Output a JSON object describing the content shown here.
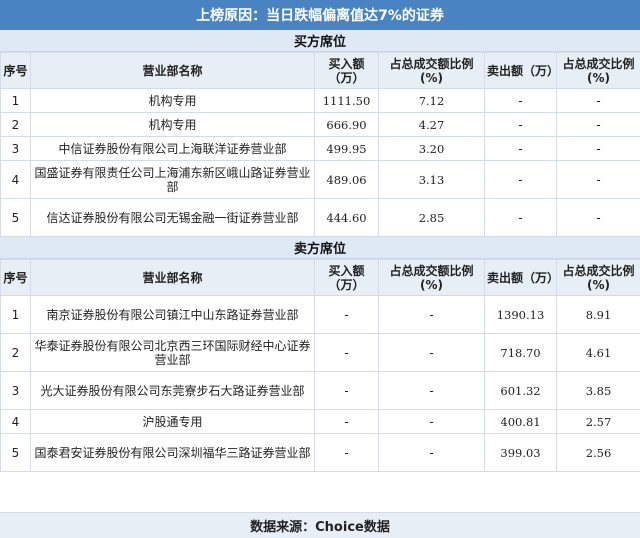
{
  "title": "上榜原因：当日跌幅偏离值达7%的证券",
  "buy": {
    "section_label": "买方席位",
    "headers": [
      "序号",
      "营业部名称",
      "买入额（万）",
      "占总成交额比例(%)",
      "卖出额（万）",
      "占总成交比例(%)"
    ],
    "rows": [
      [
        "1",
        "机构专用",
        "1111.50",
        "7.12",
        "-",
        "-"
      ],
      [
        "2",
        "机构专用",
        "666.90",
        "4.27",
        "-",
        "-"
      ],
      [
        "3",
        "中信证券股份有限公司上海联洋证券营业部",
        "499.95",
        "3.20",
        "-",
        "-"
      ],
      [
        "4",
        "国盛证券有限责任公司上海浦东新区峨山路证券营业部",
        "489.06",
        "3.13",
        "-",
        "-"
      ],
      [
        "5",
        "信达证券股份有限公司无锡金融一街证券营业部",
        "444.60",
        "2.85",
        "-",
        "-"
      ]
    ]
  },
  "sell": {
    "section_label": "卖方席位",
    "headers": [
      "序号",
      "营业部名称",
      "买入额（万）",
      "占总成交额比例(%)",
      "卖出额（万）",
      "占总成交比例(%)"
    ],
    "rows": [
      [
        "1",
        "南京证券股份有限公司镇江中山东路证券营业部",
        "-",
        "-",
        "1390.13",
        "8.91"
      ],
      [
        "2",
        "华泰证券股份有限公司北京西三环国际财经中心证券营业部",
        "-",
        "-",
        "718.70",
        "4.61"
      ],
      [
        "3",
        "光大证券股份有限公司东莞寮步石大路证券营业部",
        "-",
        "-",
        "601.32",
        "3.85"
      ],
      [
        "4",
        "沪股通专用",
        "-",
        "-",
        "400.81",
        "2.57"
      ],
      [
        "5",
        "国泰君安证券股份有限公司深圳福华三路证券营业部",
        "-",
        "-",
        "399.03",
        "2.56"
      ]
    ]
  },
  "footer": "数据来源：Choice数据"
}
